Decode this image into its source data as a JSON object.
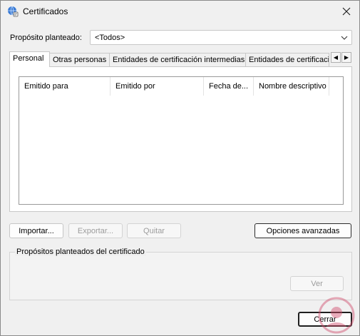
{
  "window": {
    "title": "Certificados",
    "close_glyph": "✕"
  },
  "purpose": {
    "label": "Propósito planteado:",
    "value": "<Todos>"
  },
  "tabs": [
    {
      "label": "Personal",
      "active": true
    },
    {
      "label": "Otras personas",
      "active": false
    },
    {
      "label": "Entidades de certificación intermedias",
      "active": false
    },
    {
      "label": "Entidades de certificaci",
      "active": false
    }
  ],
  "tab_scroll": {
    "left": "◀",
    "right": "▶"
  },
  "list": {
    "columns": [
      "Emitido para",
      "Emitido por",
      "Fecha de...",
      "Nombre descriptivo"
    ],
    "rows": []
  },
  "buttons": {
    "import": "Importar...",
    "export": "Exportar...",
    "remove": "Quitar",
    "advanced": "Opciones avanzadas",
    "view": "Ver",
    "close": "Cerrar"
  },
  "purposes_group": {
    "label": "Propósitos planteados del certificado"
  },
  "icons": {
    "app": "certificate-globe-icon",
    "close": "close-icon",
    "dropdown": "chevron-down-icon",
    "tab_left": "scroll-left-icon",
    "tab_right": "scroll-right-icon",
    "watermark": "watermark-logo-icon"
  }
}
